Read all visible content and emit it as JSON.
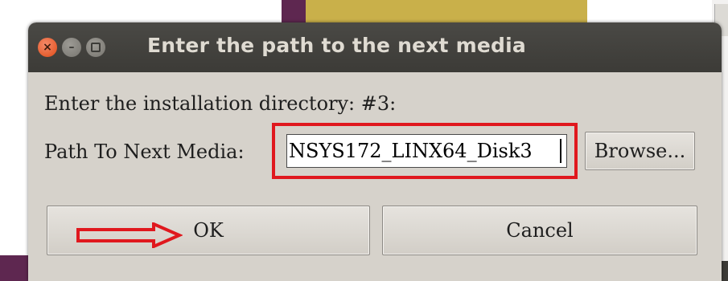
{
  "dialog": {
    "title": "Enter the path to the next media",
    "titlebar_buttons": {
      "close_glyph": "×",
      "minimize_glyph": "–"
    },
    "prompt": "Enter the installation directory: #3:",
    "path_label": "Path To Next Media:",
    "path_input_value": "NSYS172_LINX64_Disk3",
    "browse_label": "Browse...",
    "ok_label": "OK",
    "cancel_label": "Cancel"
  },
  "colors": {
    "annotation": "#e0181e",
    "titlebar": "#3c3b37",
    "dialog_bg": "#d6d2cb",
    "close_button": "#df4b16"
  },
  "icons": [
    "close-icon",
    "minimize-icon",
    "maximize-icon",
    "arrow-right-icon"
  ]
}
